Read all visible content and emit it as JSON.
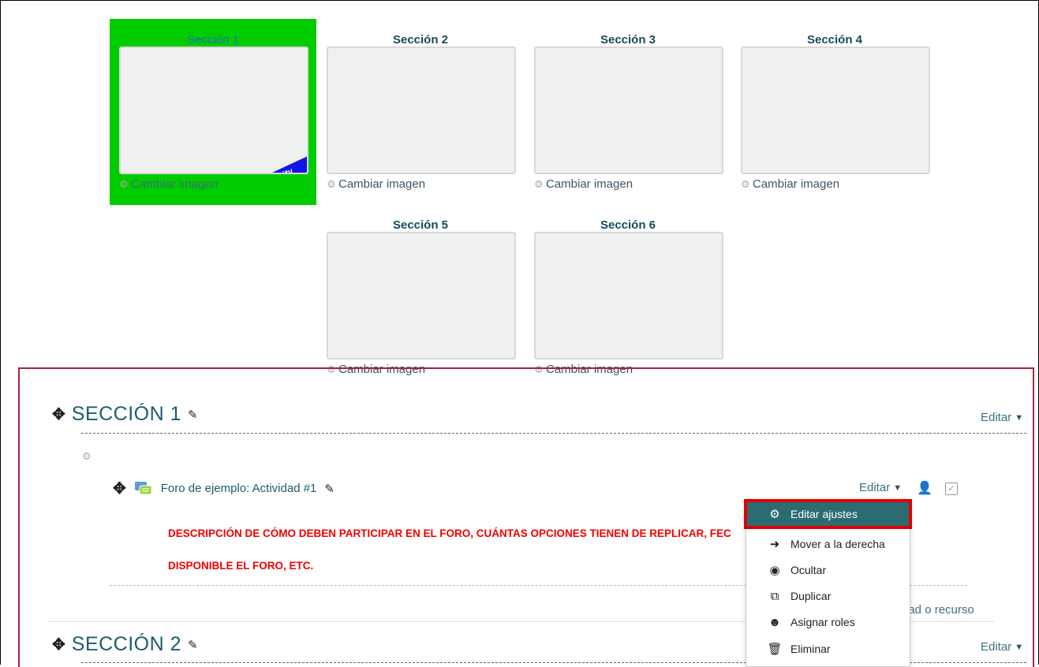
{
  "grid": {
    "tiles": [
      {
        "title": "Sección 1",
        "change": "Cambiar imagen",
        "badge": "New Activity"
      },
      {
        "title": "Sección 2",
        "change": "Cambiar imagen"
      },
      {
        "title": "Sección 3",
        "change": "Cambiar imagen"
      },
      {
        "title": "Sección 4",
        "change": "Cambiar imagen"
      },
      {
        "title": "Sección 5",
        "change": "Cambiar imagen"
      },
      {
        "title": "Sección 6",
        "change": "Cambiar imagen"
      }
    ]
  },
  "section1": {
    "title": "SECCIÓN 1",
    "edit": "Editar",
    "activity": {
      "name": "Foro de ejemplo: Actividad #1",
      "edit": "Editar",
      "desc_line1": "DESCRIPCIÓN DE CÓMO DEBEN PARTICIPAR EN EL FORO, CUÁNTAS OPCIONES TIENEN DE REPLICAR, FEC",
      "desc_line2": "DISPONIBLE EL FORO, ETC."
    },
    "add_partial": "dad o recurso"
  },
  "section2": {
    "title": "SECCIÓN 2",
    "edit": "Editar"
  },
  "menu": {
    "items": [
      {
        "label": "Editar ajustes",
        "icon": "gear-icon"
      },
      {
        "label": "Mover a la derecha",
        "icon": "arrow-right-icon"
      },
      {
        "label": "Ocultar",
        "icon": "eye-icon"
      },
      {
        "label": "Duplicar",
        "icon": "copy-icon"
      },
      {
        "label": "Asignar roles",
        "icon": "user-circle-icon"
      },
      {
        "label": "Eliminar",
        "icon": "trash-icon"
      }
    ]
  },
  "colors": {
    "current_tile": "#00cc00",
    "section_border": "#a8233f",
    "menu_active": "#2d6b72",
    "highlight": "#e00000",
    "desc_text": "#f00000"
  }
}
